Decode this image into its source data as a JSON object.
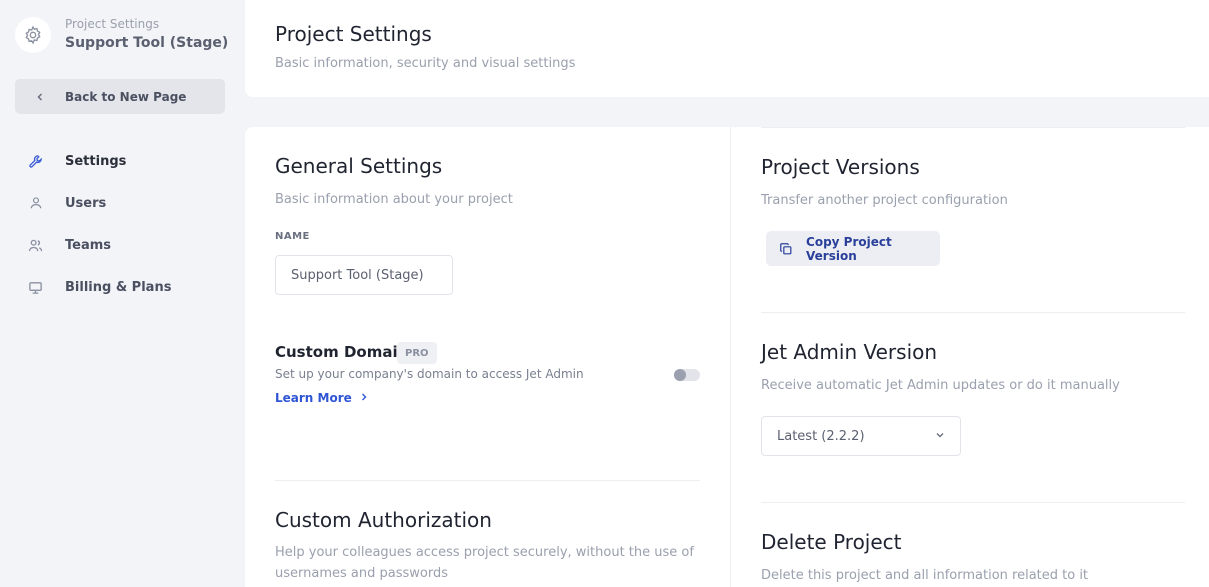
{
  "sidebar": {
    "project_subtitle": "Project Settings",
    "project_name": "Support Tool (Stage)",
    "back_label": "Back to New Page",
    "items": [
      {
        "label": "Settings",
        "icon": "wrench-icon",
        "active": true
      },
      {
        "label": "Users",
        "icon": "user-icon",
        "active": false
      },
      {
        "label": "Teams",
        "icon": "team-icon",
        "active": false
      },
      {
        "label": "Billing & Plans",
        "icon": "billing-icon",
        "active": false
      }
    ]
  },
  "header": {
    "title": "Project Settings",
    "subtitle": "Basic information, security and visual settings"
  },
  "general": {
    "title": "General Settings",
    "subtitle": "Basic information about your project",
    "name_label": "NAME",
    "name_value": "Support Tool (Stage)"
  },
  "custom_domain": {
    "title": "Custom Domain",
    "badge": "PRO",
    "description": "Set up your company's domain to access Jet Admin",
    "learn_more": "Learn More",
    "enabled": false
  },
  "custom_auth": {
    "title": "Custom Authorization",
    "subtitle": "Help your colleagues access project securely, without the use of usernames and passwords"
  },
  "versions": {
    "title": "Project Versions",
    "subtitle": "Transfer another project configuration",
    "copy_label": "Copy Project Version"
  },
  "jet_admin": {
    "title": "Jet Admin Version",
    "subtitle": "Receive automatic Jet Admin updates or do it manually",
    "selected": "Latest (2.2.2)"
  },
  "delete": {
    "title": "Delete Project",
    "subtitle": "Delete this project and all information related to it"
  },
  "colors": {
    "accent": "#2f55d4",
    "background": "#f3f4f8"
  }
}
